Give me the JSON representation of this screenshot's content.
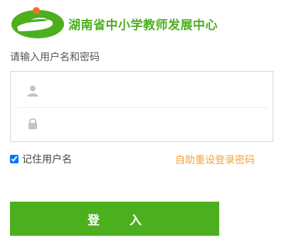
{
  "header": {
    "logo_icon": "green-s-road-logo",
    "title": "湖南省中小学教师发展中心"
  },
  "login": {
    "prompt": "请输入用户名和密码",
    "username": {
      "icon": "user-icon",
      "value": "",
      "placeholder": ""
    },
    "password": {
      "icon": "lock-icon",
      "value": "",
      "placeholder": ""
    },
    "remember_label": "记住用户名",
    "remember_checked": true,
    "reset_link": "自助重设登录密码",
    "submit_label": "登 入"
  },
  "colors": {
    "brand_green": "#4caf1e",
    "reset_orange": "#f0a43a"
  }
}
